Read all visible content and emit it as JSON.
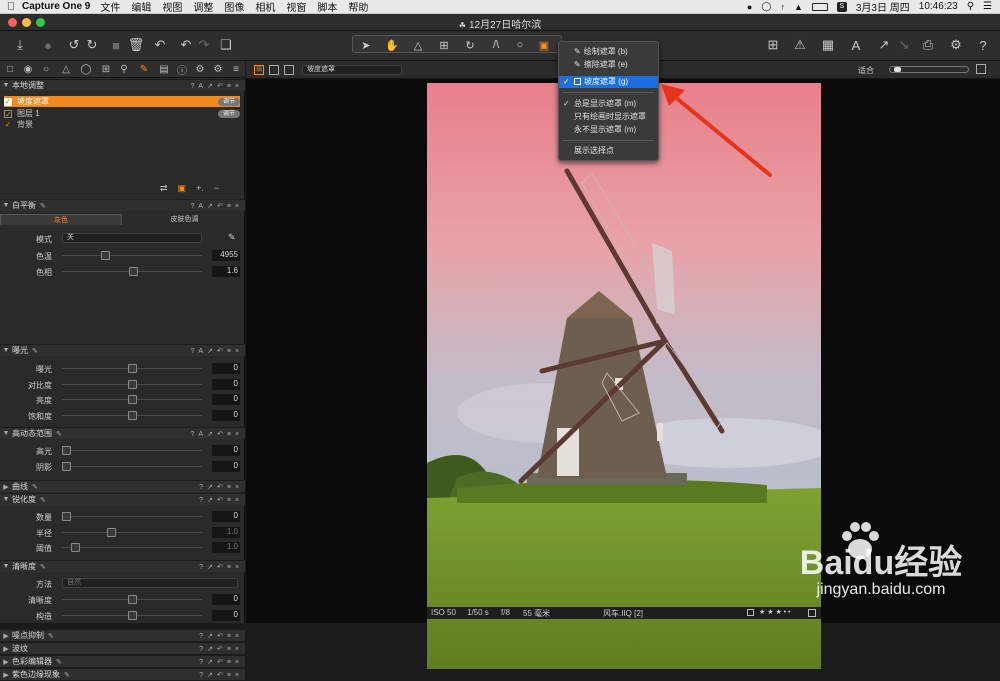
{
  "menubar": {
    "app_name": "Capture One 9",
    "items": [
      "文件",
      "编辑",
      "视图",
      "调整",
      "图像",
      "相机",
      "视窗",
      "脚本",
      "帮助"
    ],
    "date": "3月3日 周四",
    "time": "10:46:23"
  },
  "window": {
    "title": "12月27日哈尔滨"
  },
  "tools_panel": {
    "local_adjust": {
      "title": "本地调整",
      "layers": [
        {
          "name": "坡度遮罩",
          "badge": "调节",
          "selected": true
        },
        {
          "name": "图层 1",
          "badge": "调节",
          "selected": false
        },
        {
          "name": "背景",
          "badge": "",
          "selected": false
        }
      ]
    },
    "white_balance": {
      "title": "白平衡",
      "tabs": [
        "灰色",
        "皮肤色调"
      ],
      "mode_label": "模式",
      "mode_value": "关",
      "rows": [
        {
          "label": "色温",
          "value": "4955",
          "pos": 0.3
        },
        {
          "label": "色相",
          "value": "1.6",
          "pos": 0.51
        }
      ]
    },
    "exposure": {
      "title": "曝光",
      "rows": [
        {
          "label": "曝光",
          "value": "0",
          "pos": 0.5
        },
        {
          "label": "对比度",
          "value": "0",
          "pos": 0.5
        },
        {
          "label": "亮度",
          "value": "0",
          "pos": 0.5
        },
        {
          "label": "饱和度",
          "value": "0",
          "pos": 0.5
        }
      ]
    },
    "hdr": {
      "title": "高动态范围",
      "rows": [
        {
          "label": "高光",
          "value": "0",
          "pos": 0.0
        },
        {
          "label": "阴影",
          "value": "0",
          "pos": 0.0
        }
      ]
    },
    "curve": {
      "title": "曲线"
    },
    "sharpening": {
      "title": "锐化度",
      "rows": [
        {
          "label": "数量",
          "value": "0",
          "pos": 0.0,
          "dim": false
        },
        {
          "label": "半径",
          "value": "1.0",
          "pos": 0.34,
          "dim": true
        },
        {
          "label": "阈值",
          "value": "1.0",
          "pos": 0.07,
          "dim": true
        }
      ]
    },
    "clarity": {
      "title": "清晰度",
      "method_label": "方法",
      "method_value": "自然",
      "rows": [
        {
          "label": "清晰度",
          "value": "0",
          "pos": 0.5
        },
        {
          "label": "构造",
          "value": "0",
          "pos": 0.5
        }
      ]
    },
    "collapsed": [
      "噪点抑制",
      "波纹",
      "色彩编辑器",
      "紫色边缘现象"
    ]
  },
  "viewer": {
    "mask_select": "坡度遮罩",
    "fit_label": "适合",
    "info": {
      "iso": "ISO 50",
      "shutter": "1/50 s",
      "aperture": "f/8",
      "focal": "55 毫米",
      "filename": "风车.IIQ [2]",
      "stars": "★ ★ ★ • •"
    }
  },
  "mask_menu": {
    "items": [
      {
        "label": "绘制遮罩 (b)",
        "check": false,
        "highlight": false,
        "icon": "brush-icon"
      },
      {
        "label": "擦除遮罩 (e)",
        "check": false,
        "highlight": false,
        "icon": "eraser-icon"
      },
      {
        "label": "坡度遮罩 (g)",
        "check": true,
        "highlight": true,
        "icon": "gradient-mask-icon"
      },
      {
        "label": "总是显示遮罩 (m)",
        "check": true,
        "highlight": false,
        "icon": ""
      },
      {
        "label": "只有绘画时显示遮罩",
        "check": false,
        "highlight": false,
        "icon": ""
      },
      {
        "label": "永不显示遮罩 (m)",
        "check": false,
        "highlight": false,
        "icon": ""
      },
      {
        "label": "展示选择点",
        "check": false,
        "highlight": false,
        "icon": ""
      }
    ]
  },
  "watermark": {
    "brand": "Baidu经验",
    "url": "jingyan.baidu.com"
  },
  "colors": {
    "accent": "#f08a1c",
    "menu_highlight": "#1d6fe0",
    "arrow": "#e8321e"
  }
}
